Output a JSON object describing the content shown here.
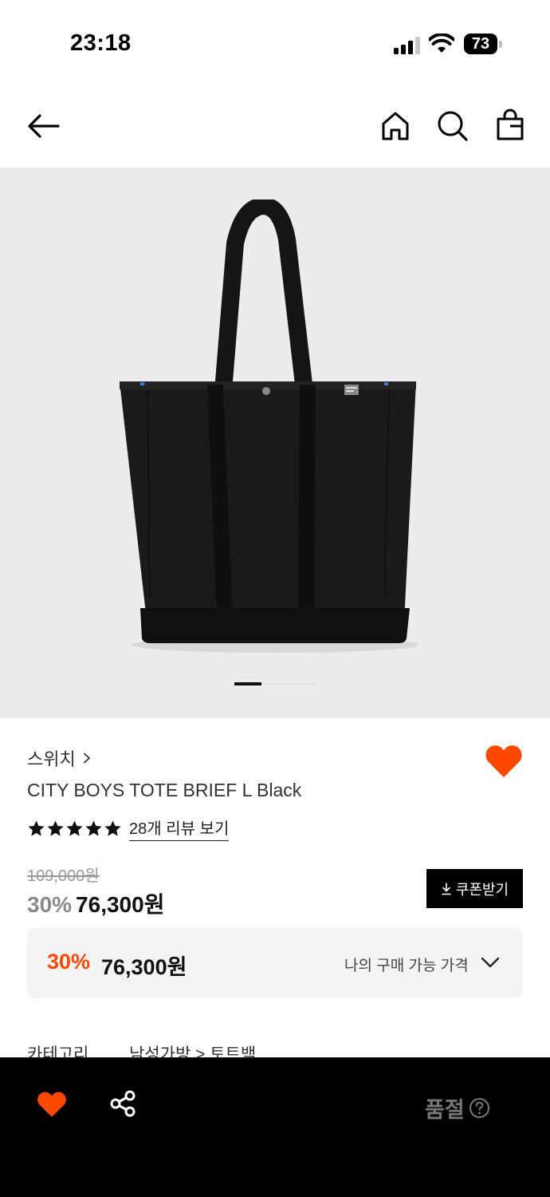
{
  "status_bar": {
    "time": "23:18",
    "battery": "73"
  },
  "nav": {
    "back": "back-arrow",
    "home": "home-icon",
    "search": "search-icon",
    "cart": "shopping-bag-icon"
  },
  "gallery": {
    "total_images": 3,
    "current_image": 1
  },
  "product": {
    "brand": "스위치",
    "name": "CITY BOYS TOTE BRIEF L Black",
    "rating_stars": 5,
    "review_link": "28개 리뷰 보기",
    "original_price": "109,000원",
    "discount_rate": "30%",
    "price": "76,300원",
    "liked": true
  },
  "coupon": {
    "label": "쿠폰받기",
    "icon": "download-icon"
  },
  "best_price": {
    "discount_rate": "30%",
    "price": "76,300원",
    "label": "나의 구매 가능 가격"
  },
  "category": {
    "label": "카테고리",
    "path": "남성가방 > 토트백"
  },
  "bottom_bar": {
    "soldout_label": "품절"
  },
  "colors": {
    "accent": "#ff4800",
    "bottom_bar_bg": "#000000",
    "image_bg": "#ececec"
  }
}
